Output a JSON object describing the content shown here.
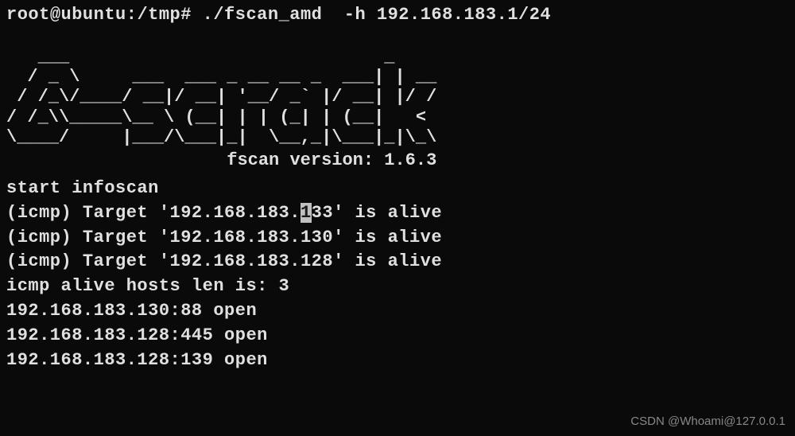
{
  "prompt": {
    "user": "root",
    "host": "ubuntu",
    "cwd": "/tmp",
    "symbol": "#",
    "command": "./fscan_amd  -h 192.168.183.1/24"
  },
  "ascii_art": "   ___                              _\n  / _ \\     ___  ___ _ __ __ _  ___| | __\n / /_\\/____/ __|/ __| '__/ _` |/ __| |/ /\n/ /_\\\\_____\\__ \\ (__| | | (_| | (__|   <\n\\____/     |___/\\___|_|  \\__,_|\\___|_|\\_\\",
  "version": {
    "prefix": "                     fscan version: ",
    "number": "1.6.3"
  },
  "scan_start": "start infoscan",
  "icmp_results": [
    {
      "pre": "(icmp) Target '192.168.183.",
      "hl": "1",
      "post": "33' is alive"
    },
    {
      "pre": "(icmp) Target '192.168.183.130' is alive",
      "hl": "",
      "post": ""
    },
    {
      "pre": "(icmp) Target '192.168.183.128' is alive",
      "hl": "",
      "post": ""
    }
  ],
  "alive_summary": "icmp alive hosts len is: 3",
  "open_ports": [
    "192.168.183.130:88 open",
    "192.168.183.128:445 open",
    "192.168.183.128:139 open"
  ],
  "watermark": "CSDN @Whoami@127.0.0.1"
}
